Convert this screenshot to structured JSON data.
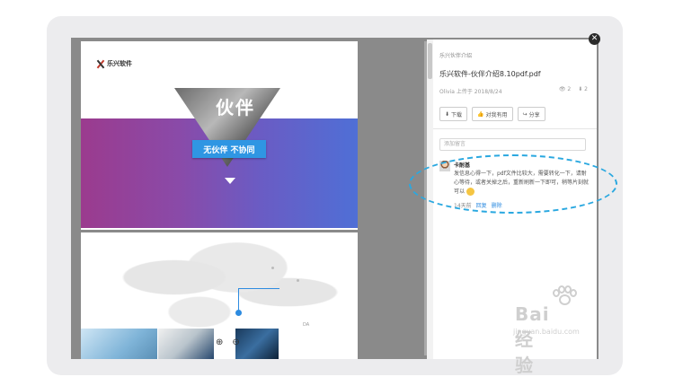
{
  "document": {
    "logo_text": "乐兴软件",
    "headline": "伙伴",
    "slogan": "无伙伴 不协同",
    "map_tag": "DA"
  },
  "panel": {
    "breadcrumb": "乐兴伙伴介绍",
    "title": "乐兴软件-伙伴介绍8.10pdf.pdf",
    "meta": "Olivia 上传于 2018/8/24",
    "views": "2",
    "downloads": "2",
    "buttons": {
      "download": "下载",
      "useful": "对我有用",
      "share": "分享"
    },
    "comment_placeholder": "添加留言",
    "comment": {
      "user": "卡耐基",
      "text": "发信息心得一下，pdf文件比较大，需要转化一下，请耐心等待，或者关掉之后，重新刷新一下即可，稍等片刻就可以",
      "time": "14天前",
      "reply": "回复",
      "delete": "删除"
    }
  },
  "watermark": {
    "text": "Bai 经验",
    "url": "jingyan.baidu.com"
  },
  "colors": {
    "accent": "#2d8be0",
    "highlight": "#2aa8e0",
    "banner_left": "#9b3b8e",
    "banner_right": "#4f6fd6"
  },
  "icons": [
    "close-icon",
    "download-icon",
    "thumbs-up-icon",
    "share-icon",
    "eye-icon",
    "download-count-icon",
    "zoom-in-icon",
    "zoom-out-icon"
  ]
}
